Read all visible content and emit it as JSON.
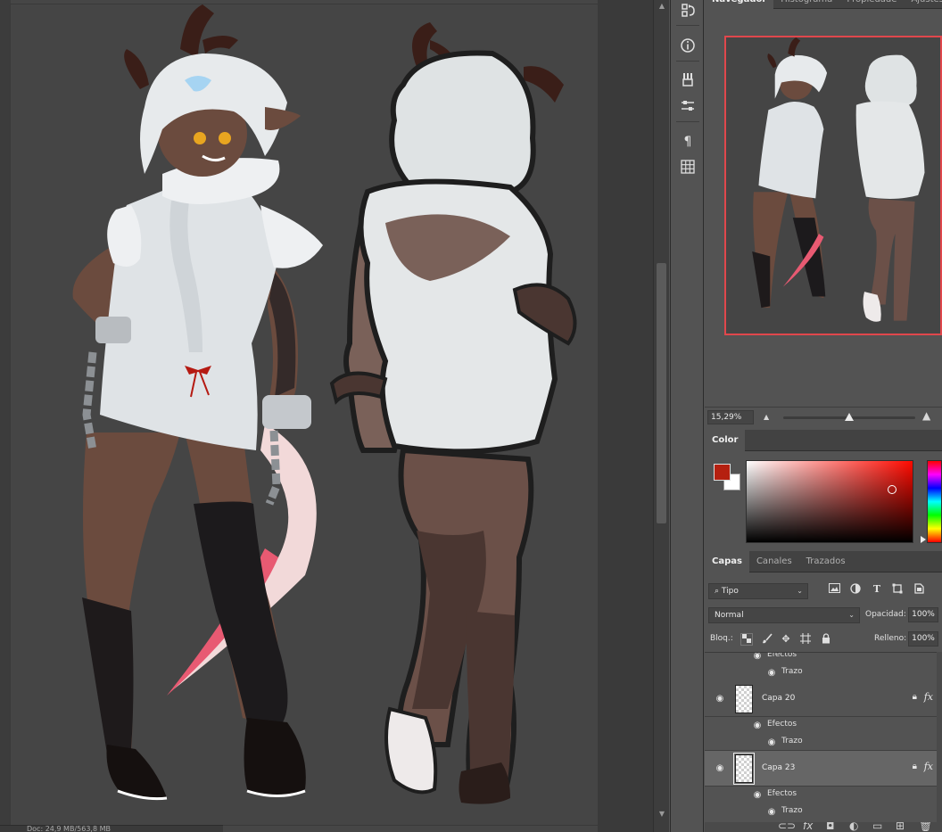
{
  "navigator": {
    "tabs": [
      "Navegador",
      "Histograma",
      "Propiedade",
      "Ajustes"
    ],
    "zoom": "15,29%",
    "zoom_fraction": 0.5
  },
  "color_panel": {
    "tab": "Color",
    "foreground": "#b52010",
    "background": "#ffffff"
  },
  "layers_panel": {
    "tabs": [
      "Capas",
      "Canales",
      "Trazados"
    ],
    "filter_kind": "Tipo",
    "blend_mode": "Normal",
    "opacity_label": "Opacidad:",
    "opacity": "100%",
    "lock_label": "Bloq.:",
    "fill_label": "Relleno:",
    "fill": "100%",
    "partial_row": {
      "effects": "Efectos",
      "stroke": "Trazo"
    },
    "layers": [
      {
        "name": "Capa 20",
        "effects": "Efectos",
        "stroke": "Trazo",
        "fx": "fx"
      },
      {
        "name": "Capa 23",
        "effects": "Efectos",
        "stroke": "Trazo",
        "fx": "fx"
      }
    ]
  },
  "status": {
    "doc": "Doc: 24,9 MB/563,8 MB"
  },
  "icons": {
    "tools": [
      "history-brush-icon",
      "info-icon",
      "brush-presets-icon",
      "adjustments-icon",
      "paragraph-icon",
      "grid-icon"
    ],
    "layer_filters": [
      "image-filter-icon",
      "adjustment-filter-icon",
      "type-filter-icon",
      "shape-filter-icon",
      "smart-object-filter-icon"
    ],
    "locks": [
      "lock-transparent-icon",
      "lock-brush-icon",
      "lock-move-icon",
      "lock-artboard-icon",
      "lock-all-icon"
    ]
  }
}
